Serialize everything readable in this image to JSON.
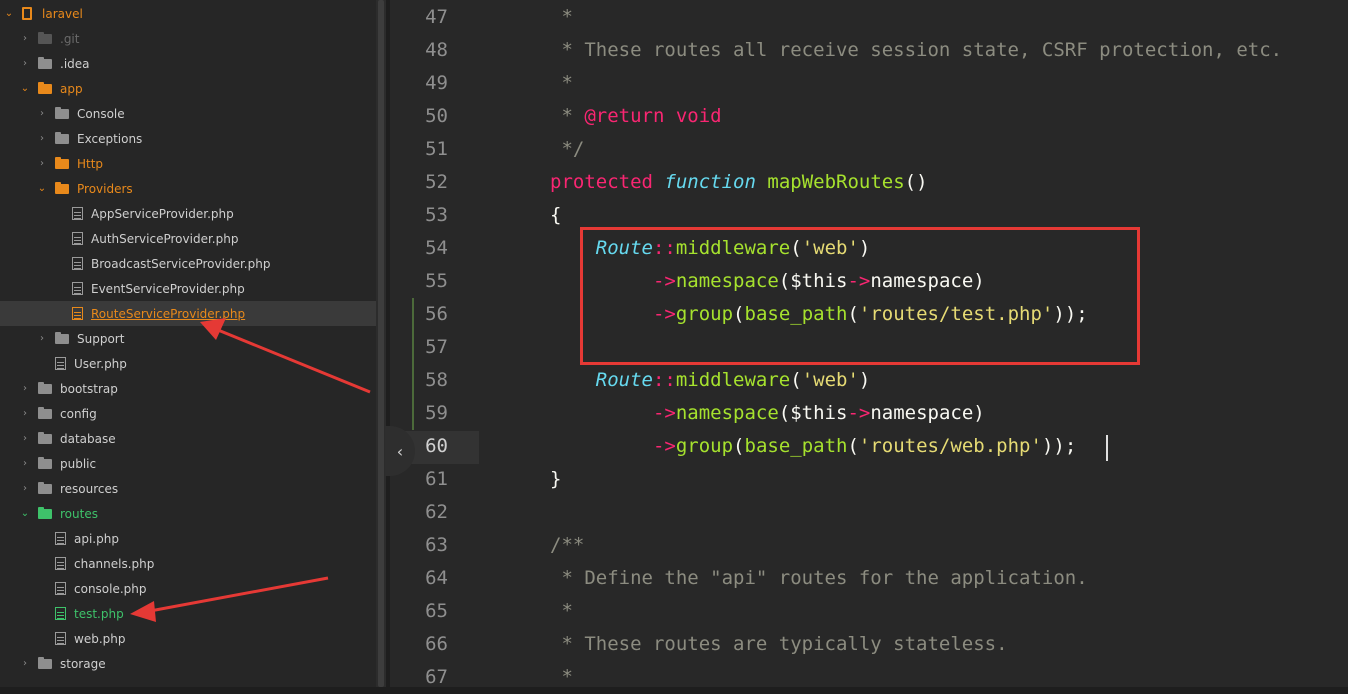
{
  "sidebar": {
    "items": [
      {
        "label": "laravel",
        "kind": "project",
        "state": "open",
        "depth": 0,
        "color": "orange"
      },
      {
        "label": ".git",
        "kind": "folder",
        "state": "closed",
        "depth": 1,
        "color": "dim"
      },
      {
        "label": ".idea",
        "kind": "folder",
        "state": "closed",
        "depth": 1,
        "color": "normal"
      },
      {
        "label": "app",
        "kind": "folder",
        "state": "open",
        "depth": 1,
        "color": "orange"
      },
      {
        "label": "Console",
        "kind": "folder",
        "state": "closed",
        "depth": 2,
        "color": "normal"
      },
      {
        "label": "Exceptions",
        "kind": "folder",
        "state": "closed",
        "depth": 2,
        "color": "normal"
      },
      {
        "label": "Http",
        "kind": "folder",
        "state": "closed",
        "depth": 2,
        "color": "orange"
      },
      {
        "label": "Providers",
        "kind": "folder",
        "state": "open",
        "depth": 2,
        "color": "orange"
      },
      {
        "label": "AppServiceProvider.php",
        "kind": "file",
        "depth": 3,
        "color": "normal"
      },
      {
        "label": "AuthServiceProvider.php",
        "kind": "file",
        "depth": 3,
        "color": "normal"
      },
      {
        "label": "BroadcastServiceProvider.php",
        "kind": "file",
        "depth": 3,
        "color": "normal"
      },
      {
        "label": "EventServiceProvider.php",
        "kind": "file",
        "depth": 3,
        "color": "normal"
      },
      {
        "label": "RouteServiceProvider.php",
        "kind": "file",
        "depth": 3,
        "color": "orange",
        "selected": true
      },
      {
        "label": "Support",
        "kind": "folder",
        "state": "closed",
        "depth": 2,
        "color": "normal"
      },
      {
        "label": "User.php",
        "kind": "file",
        "depth": 2,
        "color": "normal"
      },
      {
        "label": "bootstrap",
        "kind": "folder",
        "state": "closed",
        "depth": 1,
        "color": "normal"
      },
      {
        "label": "config",
        "kind": "folder",
        "state": "closed",
        "depth": 1,
        "color": "normal"
      },
      {
        "label": "database",
        "kind": "folder",
        "state": "closed",
        "depth": 1,
        "color": "normal"
      },
      {
        "label": "public",
        "kind": "folder",
        "state": "closed",
        "depth": 1,
        "color": "normal"
      },
      {
        "label": "resources",
        "kind": "folder",
        "state": "closed",
        "depth": 1,
        "color": "normal"
      },
      {
        "label": "routes",
        "kind": "folder",
        "state": "open",
        "depth": 1,
        "color": "green"
      },
      {
        "label": "api.php",
        "kind": "file",
        "depth": 2,
        "color": "normal"
      },
      {
        "label": "channels.php",
        "kind": "file",
        "depth": 2,
        "color": "normal"
      },
      {
        "label": "console.php",
        "kind": "file",
        "depth": 2,
        "color": "normal"
      },
      {
        "label": "test.php",
        "kind": "file",
        "depth": 2,
        "color": "green"
      },
      {
        "label": "web.php",
        "kind": "file",
        "depth": 2,
        "color": "normal"
      },
      {
        "label": "storage",
        "kind": "folder",
        "state": "closed",
        "depth": 1,
        "color": "normal"
      }
    ]
  },
  "editor": {
    "current_line": 60,
    "lines": [
      {
        "n": 47,
        "tokens": [
          [
            "cm",
            " *"
          ]
        ]
      },
      {
        "n": 48,
        "tokens": [
          [
            "cm",
            " * These routes all receive session state, CSRF protection, etc."
          ]
        ]
      },
      {
        "n": 49,
        "tokens": [
          [
            "cm",
            " *"
          ]
        ]
      },
      {
        "n": 50,
        "tokens": [
          [
            "cm",
            " * "
          ],
          [
            "kw",
            "@return"
          ],
          [
            "cm",
            " "
          ],
          [
            "kw",
            "void"
          ]
        ]
      },
      {
        "n": 51,
        "tokens": [
          [
            "cm",
            " */"
          ]
        ]
      },
      {
        "n": 52,
        "tokens": [
          [
            "kw",
            "protected"
          ],
          [
            "",
            " "
          ],
          [
            "sg",
            "function"
          ],
          [
            "",
            " "
          ],
          [
            "fn",
            "mapWebRoutes"
          ],
          [
            "",
            "()"
          ]
        ]
      },
      {
        "n": 53,
        "tokens": [
          [
            "",
            "{"
          ]
        ]
      },
      {
        "n": 54,
        "tokens": [
          [
            "",
            "    "
          ],
          [
            "cl",
            "Route"
          ],
          [
            "kw",
            "::"
          ],
          [
            "fn",
            "middleware"
          ],
          [
            "",
            "("
          ],
          [
            "st",
            "'web'"
          ],
          [
            "",
            ")"
          ]
        ]
      },
      {
        "n": 55,
        "tokens": [
          [
            "",
            "         "
          ],
          [
            "kw",
            "->"
          ],
          [
            "fn",
            "namespace"
          ],
          [
            "",
            "($this"
          ],
          [
            "kw",
            "->"
          ],
          [
            "",
            "namespace)"
          ]
        ]
      },
      {
        "n": 56,
        "tokens": [
          [
            "",
            "         "
          ],
          [
            "kw",
            "->"
          ],
          [
            "fn",
            "group"
          ],
          [
            "",
            "("
          ],
          [
            "fn",
            "base_path"
          ],
          [
            "",
            "("
          ],
          [
            "st",
            "'routes/test.php'"
          ],
          [
            "",
            "));"
          ]
        ]
      },
      {
        "n": 57,
        "tokens": []
      },
      {
        "n": 58,
        "tokens": [
          [
            "",
            "    "
          ],
          [
            "cl",
            "Route"
          ],
          [
            "kw",
            "::"
          ],
          [
            "fn",
            "middleware"
          ],
          [
            "",
            "("
          ],
          [
            "st",
            "'web'"
          ],
          [
            "",
            ")"
          ]
        ]
      },
      {
        "n": 59,
        "tokens": [
          [
            "",
            "         "
          ],
          [
            "kw",
            "->"
          ],
          [
            "fn",
            "namespace"
          ],
          [
            "",
            "($this"
          ],
          [
            "kw",
            "->"
          ],
          [
            "",
            "namespace)"
          ]
        ]
      },
      {
        "n": 60,
        "tokens": [
          [
            "",
            "         "
          ],
          [
            "kw",
            "->"
          ],
          [
            "fn",
            "group"
          ],
          [
            "",
            "("
          ],
          [
            "fn",
            "base_path"
          ],
          [
            "",
            "("
          ],
          [
            "st",
            "'routes/web.php'"
          ],
          [
            "",
            "));"
          ]
        ]
      },
      {
        "n": 61,
        "tokens": [
          [
            "",
            "}"
          ]
        ]
      },
      {
        "n": 62,
        "tokens": []
      },
      {
        "n": 63,
        "tokens": [
          [
            "cm",
            "/**"
          ]
        ]
      },
      {
        "n": 64,
        "tokens": [
          [
            "cm",
            " * Define the \"api\" routes for the application."
          ]
        ]
      },
      {
        "n": 65,
        "tokens": [
          [
            "cm",
            " *"
          ]
        ]
      },
      {
        "n": 66,
        "tokens": [
          [
            "cm",
            " * These routes are typically stateless."
          ]
        ]
      },
      {
        "n": 67,
        "tokens": [
          [
            "cm",
            " *"
          ]
        ]
      }
    ]
  },
  "colors": {
    "accent_orange": "#e8891b",
    "accent_green": "#3ec26a",
    "annotation_red": "#e53935"
  }
}
